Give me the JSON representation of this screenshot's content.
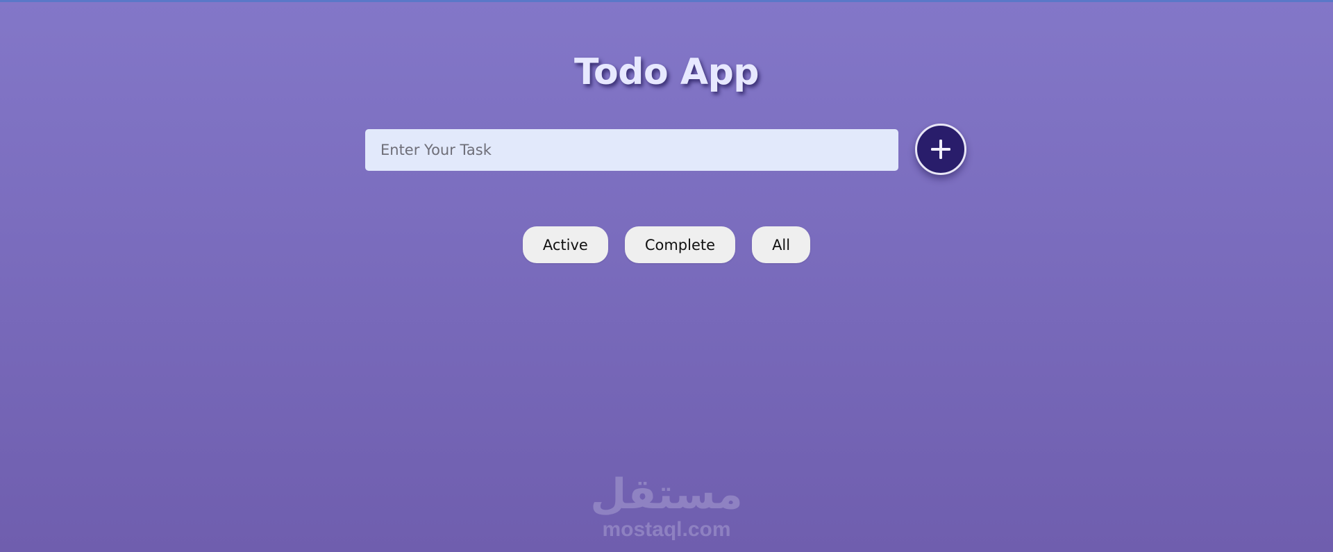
{
  "app": {
    "title": "Todo App"
  },
  "task_form": {
    "input_placeholder": "Enter Your Task",
    "input_value": "",
    "add_button_label": "+",
    "add_icon": "plus-icon"
  },
  "filters": [
    {
      "label": "Active"
    },
    {
      "label": "Complete"
    },
    {
      "label": "All"
    }
  ],
  "watermark": {
    "arabic": "مستقل",
    "latin": "mostaql.com"
  },
  "colors": {
    "background_top": "#8377c8",
    "background_bottom": "#6f5eae",
    "title": "#e7e8ff",
    "input_background": "#e2e9fb",
    "add_button": "#291d6b",
    "filter_button": "#efefef"
  }
}
